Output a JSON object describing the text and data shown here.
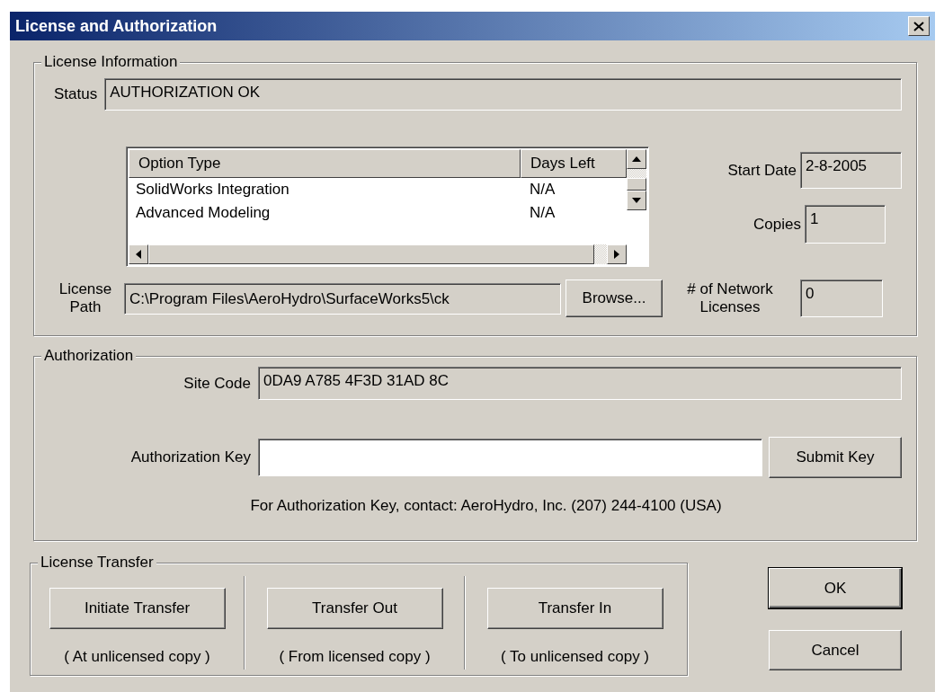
{
  "window": {
    "title": "License and Authorization"
  },
  "license_information": {
    "legend": "License Information",
    "status": {
      "label": "Status",
      "value": "AUTHORIZATION OK"
    },
    "options_table": {
      "columns": [
        "Option Type",
        "Days Left"
      ],
      "rows": [
        {
          "option_type": "SolidWorks Integration",
          "days_left": "N/A"
        },
        {
          "option_type": "Advanced Modeling",
          "days_left": "N/A"
        }
      ]
    },
    "start_date": {
      "label": "Start Date",
      "value": "2-8-2005"
    },
    "copies": {
      "label": "Copies",
      "value": "1"
    },
    "license_path": {
      "label": "License Path",
      "value": "C:\\Program Files\\AeroHydro\\SurfaceWorks5\\ck"
    },
    "browse_button": "Browse...",
    "network_licenses": {
      "label": "# of Network Licenses",
      "value": "0"
    }
  },
  "authorization": {
    "legend": "Authorization",
    "site_code": {
      "label": "Site Code",
      "value": "0DA9 A785 4F3D 31AD 8C"
    },
    "authorization_key": {
      "label": "Authorization Key"
    },
    "submit_button": "Submit Key",
    "contact": "For Authorization Key, contact: AeroHydro, Inc. (207) 244-4100 (USA)"
  },
  "license_transfer": {
    "legend": "License Transfer",
    "actions": [
      {
        "button": "Initiate Transfer",
        "note": "( At unlicensed copy )"
      },
      {
        "button": "Transfer Out",
        "note": "( From licensed copy )"
      },
      {
        "button": "Transfer In",
        "note": "( To unlicensed copy )"
      }
    ]
  },
  "buttons": [
    {
      "label": "OK",
      "default": true
    },
    {
      "label": "Cancel",
      "default": false
    }
  ]
}
